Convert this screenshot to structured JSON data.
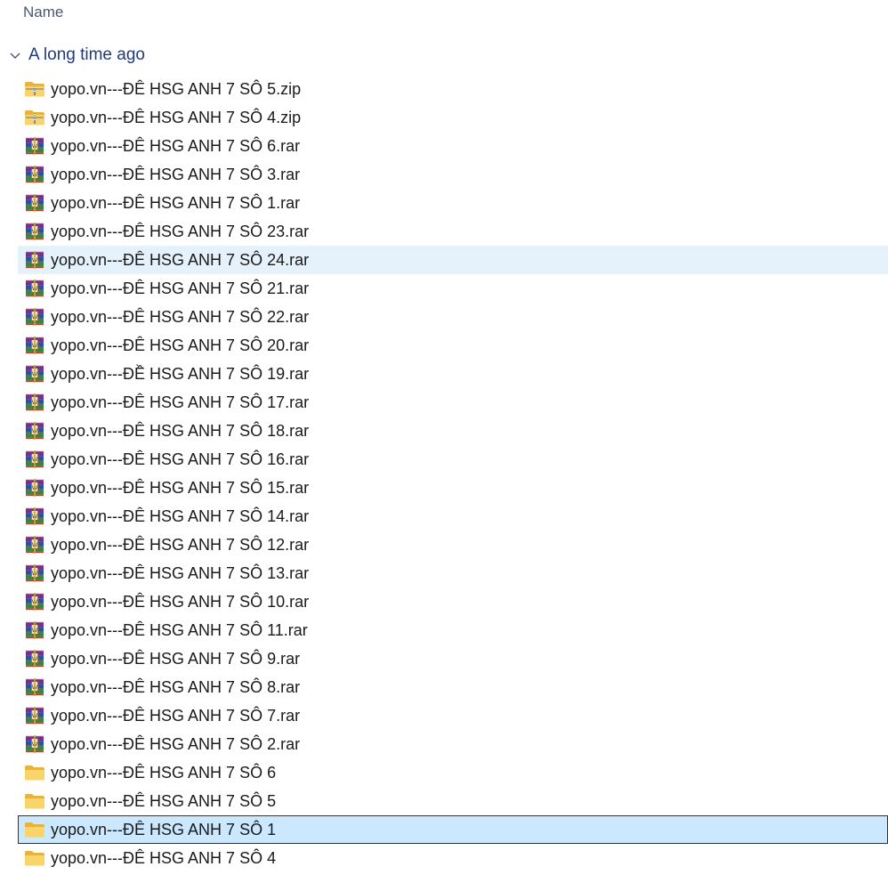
{
  "columns": {
    "name": "Name"
  },
  "group": {
    "label": "A long time ago"
  },
  "files": [
    {
      "name": "yopo.vn---ĐÊ HSG ANH 7 SÔ 5.zip",
      "icon": "zip-folder-icon",
      "state": ""
    },
    {
      "name": "yopo.vn---ĐÊ HSG ANH 7 SÔ 4.zip",
      "icon": "zip-folder-icon",
      "state": ""
    },
    {
      "name": "yopo.vn---ĐÊ HSG ANH 7 SÔ 6.rar",
      "icon": "winrar-archive-icon",
      "state": ""
    },
    {
      "name": "yopo.vn---ĐÊ HSG ANH 7 SÔ 3.rar",
      "icon": "winrar-archive-icon",
      "state": ""
    },
    {
      "name": "yopo.vn---ĐÊ HSG ANH 7 SÔ 1.rar",
      "icon": "winrar-archive-icon",
      "state": ""
    },
    {
      "name": "yopo.vn---ĐÊ HSG ANH 7 SÔ 23.rar",
      "icon": "winrar-archive-icon",
      "state": ""
    },
    {
      "name": "yopo.vn---ĐÊ HSG ANH 7 SÔ 24.rar",
      "icon": "winrar-archive-icon",
      "state": "hover"
    },
    {
      "name": "yopo.vn---ĐÊ HSG ANH 7 SÔ 21.rar",
      "icon": "winrar-archive-icon",
      "state": ""
    },
    {
      "name": "yopo.vn---ĐÊ HSG ANH 7 SÔ 22.rar",
      "icon": "winrar-archive-icon",
      "state": ""
    },
    {
      "name": "yopo.vn---ĐÊ HSG ANH 7 SÔ 20.rar",
      "icon": "winrar-archive-icon",
      "state": ""
    },
    {
      "name": "yopo.vn---ĐỀ HSG ANH 7 SÔ 19.rar",
      "icon": "winrar-archive-icon",
      "state": ""
    },
    {
      "name": "yopo.vn---ĐÊ HSG ANH 7 SÔ 17.rar",
      "icon": "winrar-archive-icon",
      "state": ""
    },
    {
      "name": "yopo.vn---ĐÊ HSG ANH 7 SÔ 18.rar",
      "icon": "winrar-archive-icon",
      "state": ""
    },
    {
      "name": "yopo.vn---ĐÊ HSG ANH 7 SÔ 16.rar",
      "icon": "winrar-archive-icon",
      "state": ""
    },
    {
      "name": "yopo.vn---ĐÊ HSG ANH 7 SÔ 15.rar",
      "icon": "winrar-archive-icon",
      "state": ""
    },
    {
      "name": "yopo.vn---ĐÊ HSG ANH 7 SÔ 14.rar",
      "icon": "winrar-archive-icon",
      "state": ""
    },
    {
      "name": "yopo.vn---ĐÊ HSG ANH 7 SÔ 12.rar",
      "icon": "winrar-archive-icon",
      "state": ""
    },
    {
      "name": "yopo.vn---ĐÊ HSG ANH 7 SÔ 13.rar",
      "icon": "winrar-archive-icon",
      "state": ""
    },
    {
      "name": "yopo.vn---ĐÊ HSG ANH 7 SÔ 10.rar",
      "icon": "winrar-archive-icon",
      "state": ""
    },
    {
      "name": "yopo.vn---ĐÊ HSG ANH 7 SÔ 11.rar",
      "icon": "winrar-archive-icon",
      "state": ""
    },
    {
      "name": "yopo.vn---ĐÊ HSG ANH 7 SÔ 9.rar",
      "icon": "winrar-archive-icon",
      "state": ""
    },
    {
      "name": "yopo.vn---ĐÊ HSG ANH 7 SÔ 8.rar",
      "icon": "winrar-archive-icon",
      "state": ""
    },
    {
      "name": "yopo.vn---ĐÊ HSG ANH 7 SÔ 7.rar",
      "icon": "winrar-archive-icon",
      "state": ""
    },
    {
      "name": "yopo.vn---ĐÊ HSG ANH 7 SÔ 2.rar",
      "icon": "winrar-archive-icon",
      "state": ""
    },
    {
      "name": "yopo.vn---ĐÊ HSG ANH 7 SÔ 6",
      "icon": "folder-icon",
      "state": ""
    },
    {
      "name": "yopo.vn---ĐÊ HSG ANH 7 SÔ 5",
      "icon": "folder-icon",
      "state": ""
    },
    {
      "name": "yopo.vn---ĐÊ HSG ANH 7 SÔ 1",
      "icon": "folder-icon",
      "state": "selected"
    },
    {
      "name": "yopo.vn---ĐÊ HSG ANH 7 SÔ 4",
      "icon": "folder-icon",
      "state": ""
    }
  ],
  "colors": {
    "hover": "#e5f1fb",
    "selected": "#cce8ff",
    "folder": "#f7c948",
    "group_label": "#1f3a7a"
  }
}
